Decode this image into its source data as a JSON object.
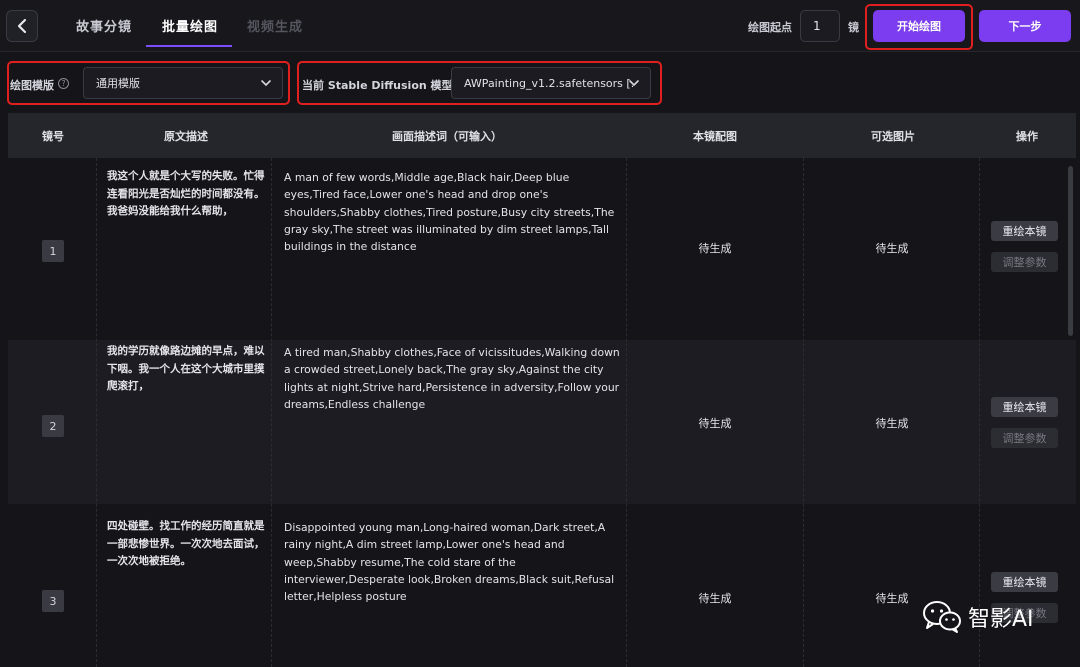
{
  "nav": {
    "tabs": [
      {
        "label": "故事分镜",
        "active": false
      },
      {
        "label": "批量绘图",
        "active": true
      },
      {
        "label": "视频生成",
        "active": false
      }
    ],
    "start_frame_label": "绘图起点",
    "start_frame_value": "1",
    "start_frame_unit": "镜",
    "start_button": "开始绘图",
    "next_button": "下一步"
  },
  "settings": {
    "template_label": "绘图模版",
    "template_value": "通用模版",
    "model_label": "当前 Stable Diffusion 模型",
    "model_value": "AWPainting_v1.2.safetensors [..."
  },
  "table": {
    "headers": [
      "镜号",
      "原文描述",
      "画面描述词（可输入）",
      "本镜配图",
      "可选图片",
      "操作"
    ],
    "redraw_label": "重绘本镜",
    "adjust_label": "调整参数",
    "rows": [
      {
        "index": "1",
        "original": "我这个人就是个大写的失败。忙得连看阳光是否灿烂的时间都没有。我爸妈没能给我什么帮助，",
        "prompt": "A man of few words,Middle age,Black hair,Deep blue eyes,Tired face,Lower one's head and drop one's shoulders,Shabby clothes,Tired posture,Busy city streets,The gray sky,The street was illuminated by dim street lamps,Tall buildings in the distance",
        "image_status": "待生成",
        "options_status": "待生成"
      },
      {
        "index": "2",
        "original": "我的学历就像路边摊的早点，难以下咽。我一个人在这个大城市里摸爬滚打，",
        "prompt": "A tired man,Shabby clothes,Face of vicissitudes,Walking down a crowded street,Lonely back,The gray sky,Against the city lights at night,Strive hard,Persistence in adversity,Follow your dreams,Endless challenge",
        "image_status": "待生成",
        "options_status": "待生成"
      },
      {
        "index": "3",
        "original": "四处碰壁。找工作的经历简直就是一部悲惨世界。一次次地去面试，一次次地被拒绝。",
        "prompt": "Disappointed young man,Long-haired woman,Dark street,A rainy night,A dim street lamp,Lower one's head and weep,Shabby resume,The cold stare of the interviewer,Desperate look,Broken dreams,Black suit,Refusal letter,Helpless posture",
        "image_status": "待生成",
        "options_status": "待生成"
      }
    ]
  },
  "watermark": {
    "text": "智影AI"
  },
  "colors": {
    "accent": "#7c3cf0",
    "highlight_box": "#e0201f",
    "background": "#141419"
  }
}
